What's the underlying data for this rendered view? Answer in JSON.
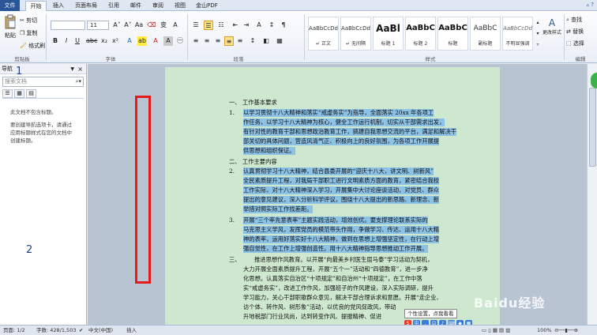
{
  "ribbon_tabs": [
    "文件",
    "开始",
    "插入",
    "页面布局",
    "引用",
    "邮件",
    "审阅",
    "视图",
    "金山PDF"
  ],
  "active_tab": "开始",
  "clipboard": {
    "paste": "粘贴",
    "cut": "剪切",
    "copy": "复制",
    "format_painter": "格式刷",
    "label": "剪贴板"
  },
  "font": {
    "name": "",
    "size": "11",
    "label": "字体",
    "bold": "B",
    "italic": "I",
    "underline": "U"
  },
  "paragraph": {
    "label": "段落"
  },
  "styles": {
    "label": "样式",
    "tiles": [
      {
        "sample": "AaBbCcDd",
        "name": "↵ 正文"
      },
      {
        "sample": "AaBbCcDd",
        "name": "↵ 无间隔"
      },
      {
        "sample": "AaBl",
        "name": "标题 1"
      },
      {
        "sample": "AaBbC",
        "name": "标题 2"
      },
      {
        "sample": "AaBbC",
        "name": "标题"
      },
      {
        "sample": "AaBbC",
        "name": "副标题"
      },
      {
        "sample": "AaBbCcDd",
        "name": "不明显强调"
      }
    ],
    "change_styles": "更改样式"
  },
  "editing": {
    "find": "查找",
    "replace": "替换",
    "select": "选择",
    "label": "编辑"
  },
  "nav": {
    "title": "导航",
    "search_placeholder": "搜索文档",
    "message_line1": "此文档不包含标题。",
    "message_line2": "要创建导航选项卡，请通过应用标题样式在您的文档中创建标题。"
  },
  "callouts": {
    "one": "1",
    "two": "2"
  },
  "document": {
    "heading1": "一、  工作基本要求",
    "heading2": "二、  工作主要内容",
    "num1": "1.",
    "num2": "1.",
    "num3": "2.",
    "num4": "3.",
    "num5": "三、",
    "p1": [
      "以学习贯彻十八大精神和落实“戒虚务实”为指导，全面落实 20xx 年各项工",
      "作任务，以学习十八大精神为核心，健全工作运行机制，切实从干部需求出发，",
      "有针对性的教育干部和思想政治教育工作，搞建自我思想交流的平台，满足和解决干",
      "部关切的具体问题，营造风清气正、积极向上的良好氛围，为各项工作开展提",
      "供思想和组织保证。"
    ],
    "p2": [
      "认真贯彻学习十八大精神，结合县委开展的“迎庆十八大，讲文明、树新风”",
      "全民素质提升工程，对我局干部职工进行文明素质方面的教育，紧密结合我校",
      "工作实际，对十八大精神深入学习，开展集中大讨论座谈活动，对党员、群众",
      "提出的意见建议，深入分析科学评议，围绕十八大提出的新思路、新理念、新",
      "举措对照实际工作找差距。"
    ],
    "p3": [
      "开展“三个率先意表率”主题实践活动，增效创优。要支撑理论联系实际的",
      "马克思主义学风，发挥党员的模范带头作用，争做学习、传达、运用十八大精",
      "神的表率，运用好落实好十八大精神，做到在思想上增强坚定性，在行动上增",
      "强自觉性，在工作上增强创造性。用十八大精神指导思想推动工作开展。"
    ],
    "p4": [
      "推进思想作风教育。以开展“向最美乡村医生屈马泰”学习活动为契机，",
      "大力开展全面素质提升工程，开展“五个一”活动和“四德教育”，进一步净",
      "化思想。认真落实自治区“十项规定”和自治州“十项规定”，在工作中落",
      "实“戒虚务实”，改进工作作风，加强班子的作风建设，深入实际调研，提升",
      "学习能力，关心干部职歌群众意见，解决干部合理诉求和意愿。开展“走企业、",
      "访个体、转作风、树形象”活动，以优良的党风促政风，带动",
      "升地税部门行业风尚，达到转变作风、提振精神、促进"
    ]
  },
  "tooltip": "个性设置，点我看看",
  "status": {
    "page": "页面: 1/2",
    "words": "字数: 428/1,503",
    "language": "中文(中国)",
    "mode": "插入",
    "zoom": "100%"
  },
  "watermark": "Baidu经验"
}
